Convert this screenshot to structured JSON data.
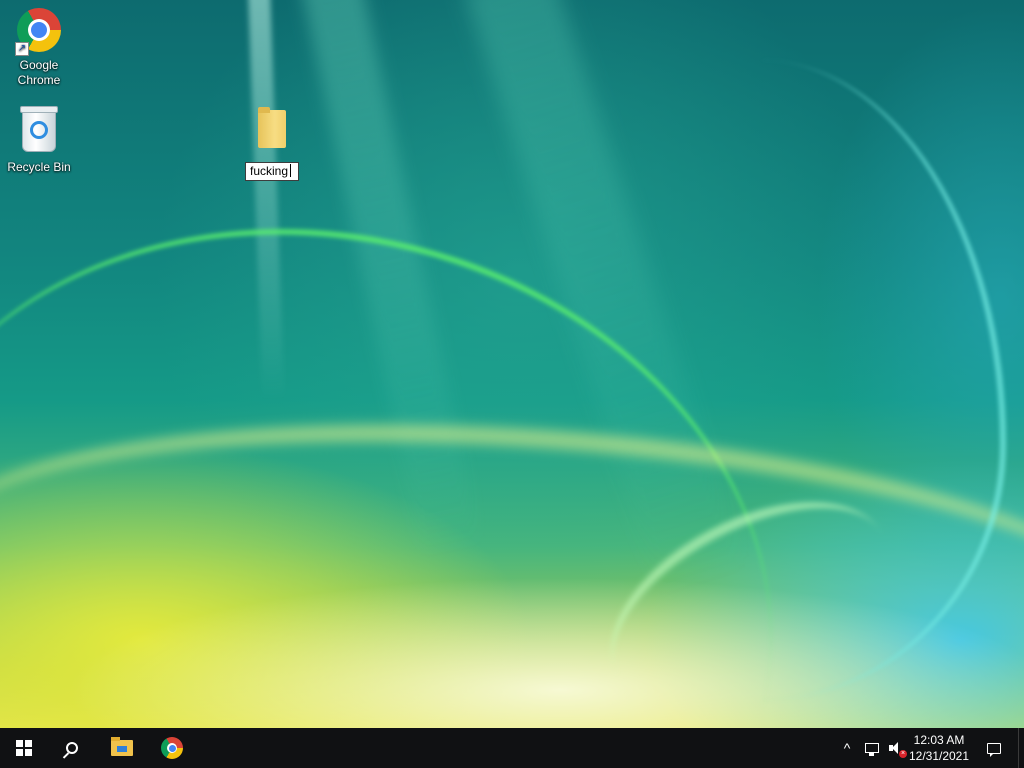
{
  "desktop": {
    "icons": [
      {
        "label": "Google\nChrome",
        "icon": "chrome-icon"
      },
      {
        "label": "Recycle Bin",
        "icon": "recycle-bin-icon"
      }
    ],
    "new_folder": {
      "icon": "folder-icon",
      "rename_value": "fucking"
    }
  },
  "taskbar": {
    "start": {
      "icon": "windows-start-icon"
    },
    "search": {
      "icon": "search-icon"
    },
    "pinned": [
      {
        "icon": "file-explorer-icon"
      },
      {
        "icon": "chrome-icon"
      }
    ],
    "tray": {
      "chevron_glyph": "^",
      "network_icon": "network-icon",
      "volume_icon": "volume-muted-icon",
      "time": "12:03 AM",
      "date": "12/31/2021",
      "notification_icon": "action-center-icon"
    }
  },
  "colors": {
    "taskbar_bg": "#101113",
    "accent": "#76b9ed"
  }
}
